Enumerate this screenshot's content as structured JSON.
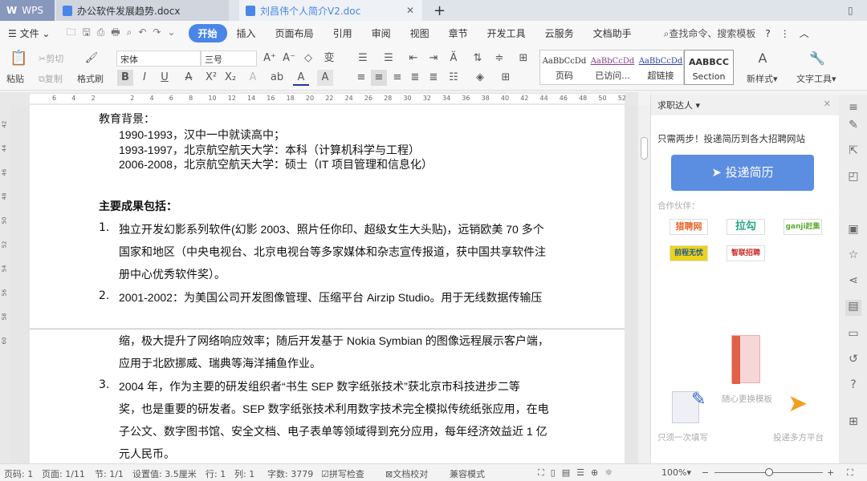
{
  "tabs": {
    "wps": "WPS",
    "doc1": "办公软件发展趋势.docx",
    "doc2": "刘昌伟个人简介V2.doc",
    "new": "+"
  },
  "menu": {
    "file": "文件",
    "items": [
      "开始",
      "插入",
      "页面布局",
      "引用",
      "审阅",
      "视图",
      "章节",
      "开发工具",
      "云服务",
      "文档助手"
    ],
    "search": "查找命令、搜索模板",
    "help": "?"
  },
  "toolbar": {
    "paste": "粘贴",
    "cut": "剪切",
    "copy": "复制",
    "format_painter": "格式刷",
    "font": "宋体",
    "size": "三号",
    "styles": [
      {
        "sample": "AaBbCcDd",
        "label": "页码"
      },
      {
        "sample": "AaBbCcDd",
        "label": "已访问..."
      },
      {
        "sample": "AaBbCcDd",
        "label": "超链接"
      },
      {
        "sample": "AABBCC",
        "label": "Section"
      }
    ],
    "new_style": "新样式",
    "text_tools": "文字工具"
  },
  "ruler": {
    "h": [
      "6",
      "4",
      "2",
      "",
      "2",
      "4",
      "6",
      "8",
      "10",
      "12",
      "14",
      "16",
      "18",
      "20",
      "22",
      "24",
      "26",
      "28",
      "30",
      "32",
      "34",
      "36",
      "38",
      "40",
      "42",
      "44",
      "46",
      "48",
      "50",
      "52"
    ],
    "v": [
      "42",
      "44",
      "46",
      "48",
      "50",
      "52",
      "54",
      "56",
      "58",
      "60"
    ]
  },
  "document": {
    "edu_title": "教育背景：",
    "edu": [
      "1990-1993，汉中一中就读高中；",
      "1993-1997，北京航空航天大学：本科（计算机科学与工程）",
      "2006-2008，北京航空航天大学：硕士（IT 项目管理和信息化）"
    ],
    "ach_title": "主要成果包括：",
    "items": [
      {
        "n": "1.",
        "lines": [
          "独立开发幻影系列软件(幻影 2003、照片任你印、超级女生大头贴)，远销欧美 70 多个",
          "国家和地区（中央电视台、北京电视台等多家媒体和杂志宣传报道，获中国共享软件注",
          "册中心优秀软件奖）。"
        ]
      },
      {
        "n": "2.",
        "lines": [
          "2001-2002：为美国公司开发图像管理、压缩平台 Airzip Studio。用于无线数据传输压"
        ]
      }
    ],
    "page2_lines": [
      "缩，极大提升了网络响应效率；随后开发基于 Nokia Symbian 的图像远程展示客户端，",
      "应用于北欧挪威、瑞典等海洋捕鱼作业。"
    ],
    "item3": {
      "n": "3.",
      "lines": [
        "2004 年，作为主要的研发组织者“书生 SEP 数字纸张技术”获北京市科技进步二等",
        "奖，也是重要的研发者。SEP 数字纸张技术利用数字技术完全模拟传统纸张应用，在电",
        "子公文、数字图书馆、安全文档、电子表单等领域得到充分应用，每年经济效益近 1 亿",
        "元人民币。"
      ]
    }
  },
  "panel": {
    "title": "求职达人",
    "tagline": "只需两步！投递简历到各大招聘网站",
    "button": "投递简历",
    "partners_label": "合作伙伴：",
    "partners": [
      "猎聘网",
      "拉勾",
      "ganji赶集",
      "前程无忧",
      "智联招聘"
    ],
    "step1": "只须一次填写",
    "step2": "随心更换模板",
    "step3": "投递多方平台"
  },
  "status": {
    "page": "页码: 1",
    "pages": "页面: 1/11",
    "section": "节: 1/1",
    "setting": "设置值: 3.5厘米",
    "row": "行: 1",
    "col": "列: 1",
    "words": "字数: 3779",
    "spell": "拼写检查",
    "proof": "文档校对",
    "compat": "兼容模式",
    "zoom": "100%",
    "zoom_fraction": 0.5
  },
  "colors": {
    "accent": "#4a86e8"
  }
}
